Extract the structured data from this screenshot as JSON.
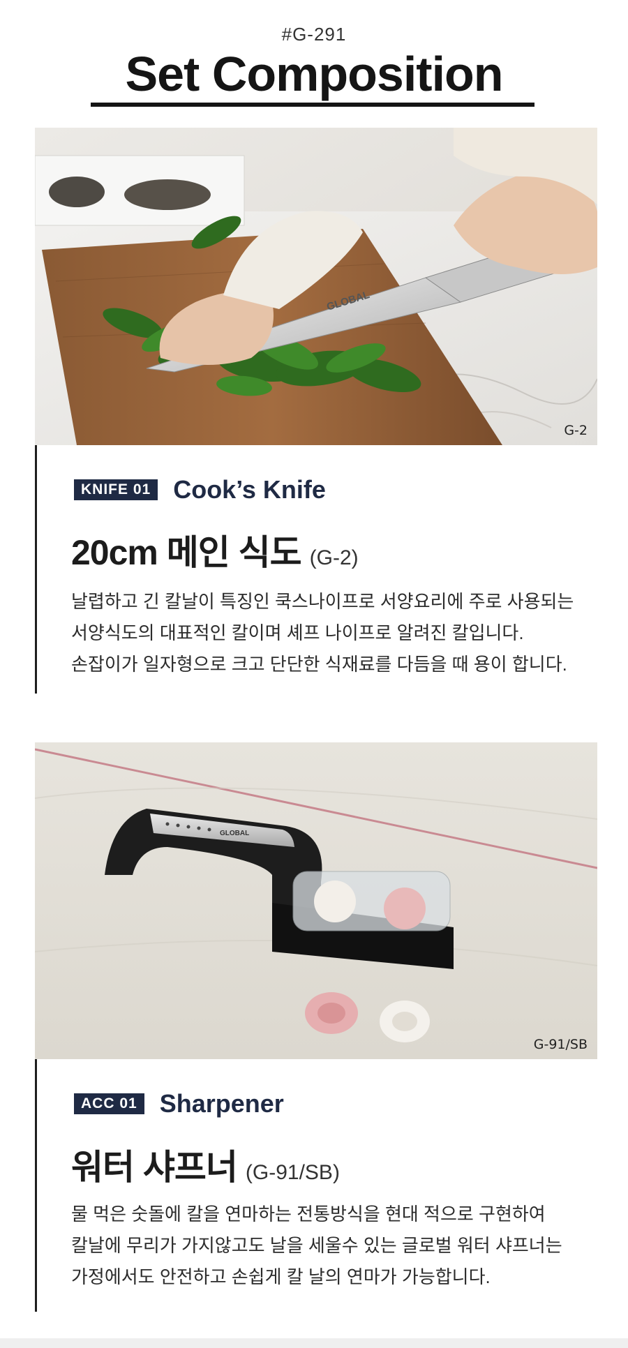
{
  "header": {
    "code": "#G-291",
    "title": "Set Composition"
  },
  "sections": [
    {
      "photo_tag": "G-2",
      "photo_icon": "cooks-knife-cutting-herbs-photo",
      "badge": "KNIFE 01",
      "label": "Cook’s Knife",
      "product_name": "20cm 메인 식도",
      "product_code": "(G-2)",
      "description": [
        "날렵하고 긴 칼날이 특징인 쿡스나이프로 서양요리에 주로 사용되는",
        "서양식도의 대표적인 칼이며 셰프 나이프로 알려진 칼입니다.",
        "손잡이가 일자형으로  크고 단단한 식재료를 다듬을 때 용이 합니다."
      ]
    },
    {
      "photo_tag": "G-91/SB",
      "photo_icon": "water-sharpener-photo",
      "badge": "ACC 01",
      "label": "Sharpener",
      "product_name": "워터 샤프너",
      "product_code": "(G-91/SB)",
      "description": [
        "물 먹은 숫돌에 칼을 연마하는 전통방식을 현대 적으로 구현하여",
        "칼날에 무리가 가지않고도 날을 세울수 있는 글로벌 워터 샤프너는",
        "가정에서도 안전하고 손쉽게 칼 날의 연마가 가능합니다."
      ]
    }
  ],
  "colors": {
    "badge_bg": "#1f2a44",
    "label_text": "#1f2a44",
    "title_text": "#151515"
  },
  "brand_print": "GLOBAL"
}
